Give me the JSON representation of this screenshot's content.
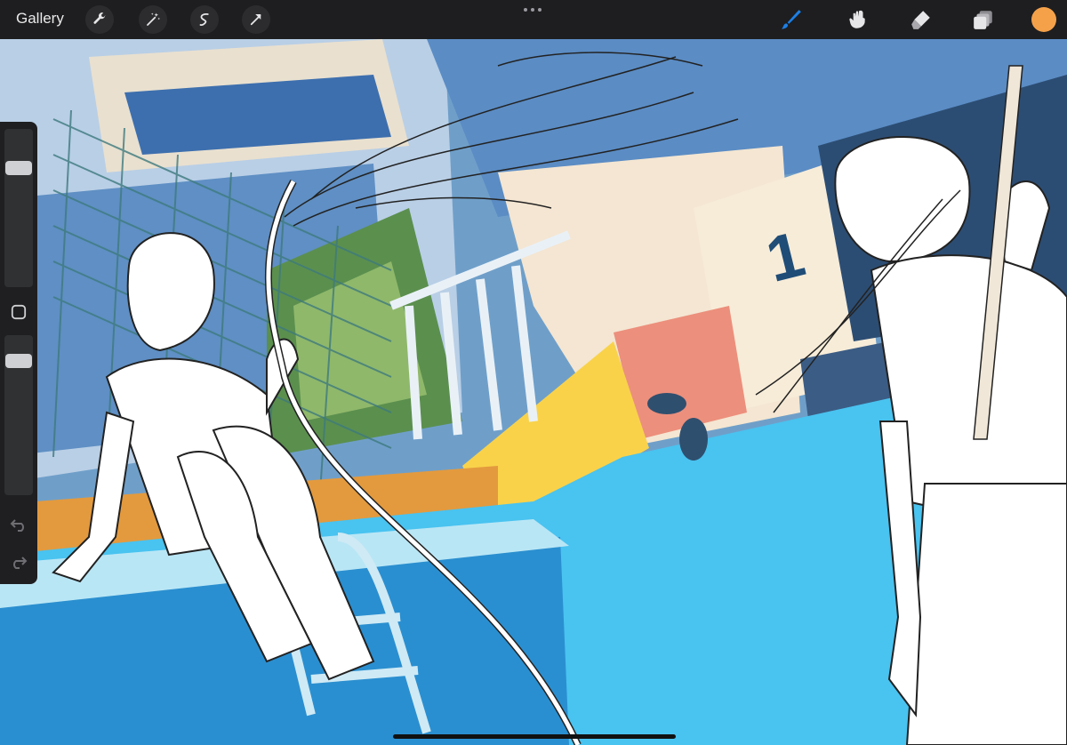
{
  "app": {
    "gallery_label": "Gallery"
  },
  "toolbar_left_icons": [
    "wrench-icon",
    "magic-wand-icon",
    "selection-icon",
    "transform-arrow-icon"
  ],
  "toolbar_right_icons": [
    "brush-icon",
    "smudge-icon",
    "eraser-icon",
    "layers-icon"
  ],
  "colors": {
    "active_tool": "#1d7fe6",
    "current_color": "#f5a14a",
    "toolbar_bg": "#1e1e20"
  },
  "sidebar": {
    "brush_size_level": 0.22,
    "opacity_level": 0.13,
    "icons": [
      "modify-square-icon",
      "undo-icon",
      "redo-icon"
    ]
  },
  "canvas": {
    "sign_number": "1"
  }
}
